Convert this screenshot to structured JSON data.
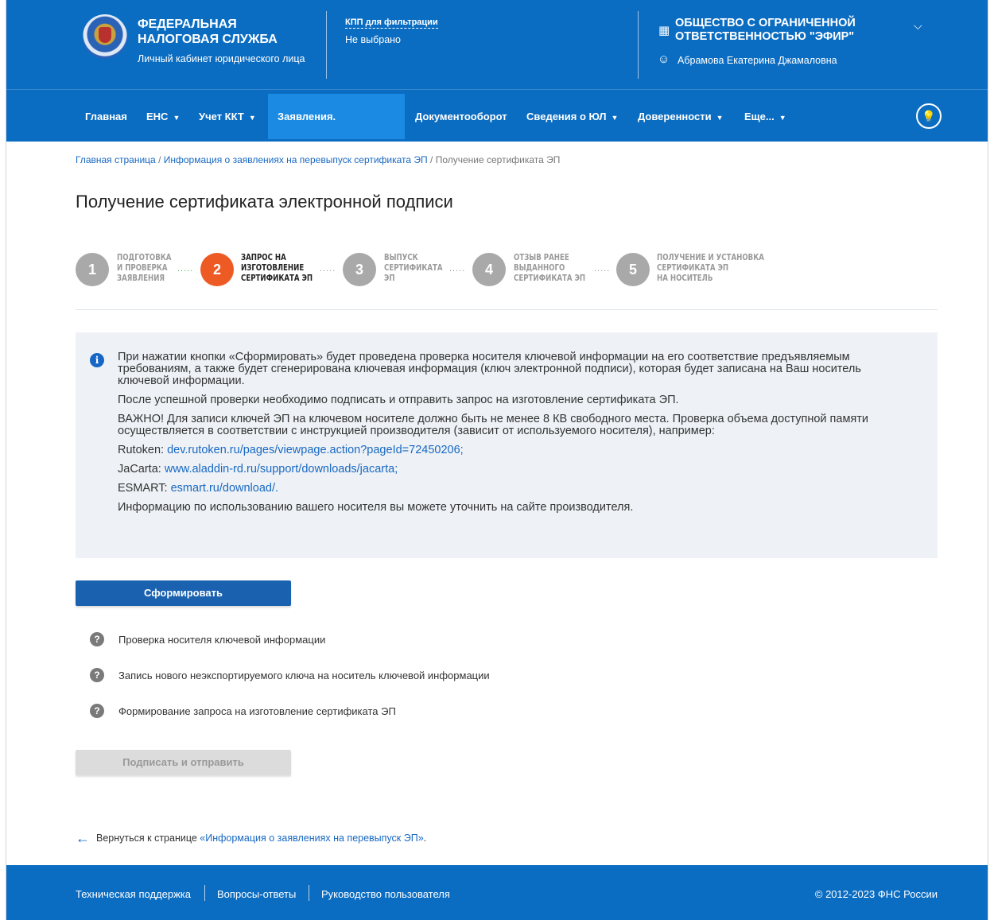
{
  "header": {
    "org_title": "ФЕДЕРАЛЬНАЯ НАЛОГОВАЯ СЛУЖБА",
    "org_subtitle": "Личный кабинет юридического лица",
    "kpp_label": "КПП для фильтрации",
    "kpp_value": "Не выбрано",
    "company": "ОБЩЕСТВО С ОГРАНИЧЕННОЙ ОТВЕТСТВЕННОСТЬЮ \"ЭФИР\"",
    "user": "Абрамова Екатерина Джамаловна"
  },
  "nav": {
    "items": [
      "Главная",
      "ЕНС",
      "Учет ККТ",
      "Заявления. Запросы",
      "Документооборот",
      "Сведения о ЮЛ",
      "Доверенности",
      "Еще..."
    ],
    "active": "Заявления. Запросы"
  },
  "breadcrumb": {
    "home": "Главная страница",
    "sep": " / ",
    "parent": "Информация о заявлениях на перевыпуск сертификата ЭП",
    "current": "Получение сертификата ЭП"
  },
  "page_title": "Получение сертификата электронной подписи",
  "steps": [
    {
      "num": "1",
      "label1": "ПОДГОТОВКА",
      "label2": "И ПРОВЕРКА",
      "label3": "ЗАЯВЛЕНИЯ"
    },
    {
      "num": "2",
      "label1": "ЗАПРОС НА",
      "label2": "ИЗГОТОВЛЕНИЕ",
      "label3": "СЕРТИФИКАТА ЭП"
    },
    {
      "num": "3",
      "label1": "ВЫПУСК",
      "label2": "СЕРТИФИКАТА",
      "label3": "ЭП"
    },
    {
      "num": "4",
      "label1": "ОТЗЫВ РАНЕЕ",
      "label2": "ВЫДАННОГО",
      "label3": "СЕРТИФИКАТА ЭП"
    },
    {
      "num": "5",
      "label1": "ПОЛУЧЕНИЕ И УСТАНОВКА",
      "label2": "СЕРТИФИКАТА ЭП",
      "label3": "НА НОСИТЕЛЬ"
    }
  ],
  "step_dots": ".....",
  "info": {
    "p1": "При нажатии кнопки «Сформировать» будет проведена проверка носителя ключевой информации на его соответствие предъявляемым требованиям, а также будет сгенерирована ключевая информация (ключ электронной подписи), которая будет записана на Ваш носитель ключевой информации.",
    "p2": "После успешной проверки необходимо подписать и отправить запрос на изготовление сертификата ЭП.",
    "p3": "ВАЖНО! Для записи ключей ЭП на ключевом носителе должно быть не менее 8 КВ свободного места. Проверка объема доступной памяти осуществляется в соответствии с инструкцией производителя (зависит от используемого носителя), например:",
    "rutoken_label": "Rutoken: ",
    "rutoken_link": "dev.rutoken.ru/pages/viewpage.action?pageId=72450206;",
    "jacarta_label": "JaCarta: ",
    "jacarta_link": "www.aladdin-rd.ru/support/downloads/jacarta;",
    "esmart_label": "ESMART: ",
    "esmart_link": "esmart.ru/download/.",
    "p4": "Информацию по использованию вашего носителя вы можете уточнить на сайте производителя."
  },
  "buttons": {
    "generate": "Сформировать",
    "sign_send": "Подписать и отправить"
  },
  "checks": [
    "Проверка носителя ключевой информации",
    "Запись нового неэкспортируемого ключа на носитель ключевой информации",
    "Формирование запроса на изготовление сертификата ЭП"
  ],
  "back": {
    "prefix": "Вернуться к странице ",
    "link": "«Информация о заявлениях на перевыпуск ЭП»",
    "suffix": "."
  },
  "footer": {
    "links": [
      "Техническая поддержка",
      "Вопросы-ответы",
      "Руководство пользователя"
    ],
    "copyright": "© 2012-2023 ФНС России"
  },
  "colors": {
    "primary": "#0b6dc2",
    "active_nav": "#1a8ae3",
    "active_step": "#ee5a24",
    "link": "#1868c2"
  }
}
